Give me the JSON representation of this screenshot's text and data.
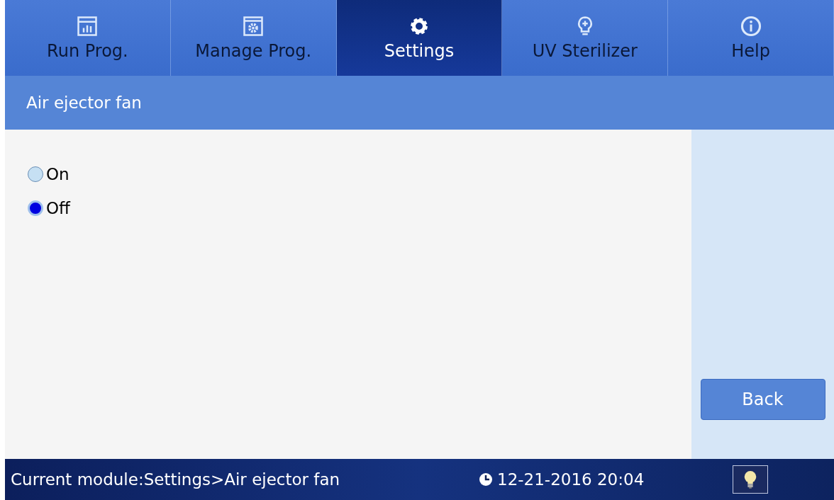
{
  "tabs": [
    {
      "label": "Run Prog.",
      "kind": "chart",
      "selected": false
    },
    {
      "label": "Manage Prog.",
      "kind": "window-gear",
      "selected": false
    },
    {
      "label": "Settings",
      "kind": "gear",
      "selected": true
    },
    {
      "label": "UV Sterilizer",
      "kind": "bulb",
      "selected": false
    },
    {
      "label": "Help",
      "kind": "info",
      "selected": false
    }
  ],
  "header": {
    "title": "Air ejector fan"
  },
  "options": [
    {
      "label": "On",
      "selected": false
    },
    {
      "label": "Off",
      "selected": true
    }
  ],
  "back_button": "Back",
  "status_bar": {
    "module": "Current module:Settings>Air ejector fan",
    "datetime": "12-21-2016 20:04"
  }
}
